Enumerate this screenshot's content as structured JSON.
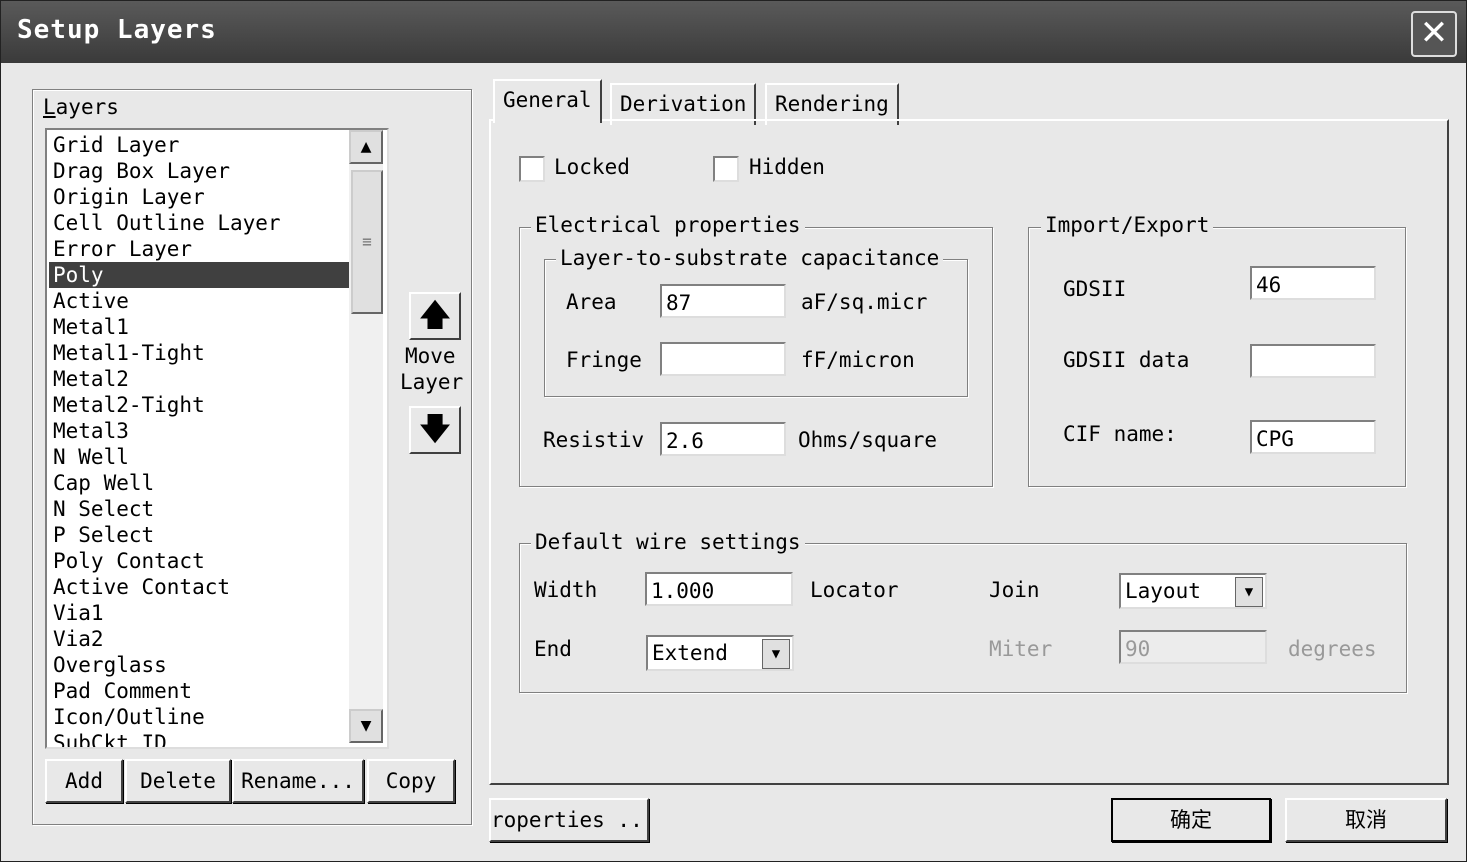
{
  "window": {
    "title": "Setup Layers",
    "close_label": "✕"
  },
  "layers": {
    "label": "Layers",
    "items": [
      "Grid Layer",
      "Drag Box Layer",
      "Origin Layer",
      "Cell Outline Layer",
      "Error Layer",
      "Poly",
      "Active",
      "Metal1",
      "Metal1-Tight",
      "Metal2",
      "Metal2-Tight",
      "Metal3",
      "N Well",
      "Cap Well",
      "N Select",
      "P Select",
      "Poly Contact",
      "Active Contact",
      "Via1",
      "Via2",
      "Overglass",
      "Pad Comment",
      "Icon/Outline",
      "SubCkt ID"
    ],
    "selected": "Poly",
    "buttons": {
      "add": "Add",
      "delete": "Delete",
      "rename": "Rename...",
      "copy": "Copy"
    },
    "move_label_line1": "Move",
    "move_label_line2": "Layer",
    "move_up_icon": "🡅",
    "move_down_icon": "🡇"
  },
  "tabs": [
    "General",
    "Derivation",
    "Rendering"
  ],
  "general": {
    "locked_label": "Locked",
    "hidden_label": "Hidden",
    "electrical": {
      "title": "Electrical properties",
      "capacitance_title": "Layer-to-substrate capacitance",
      "area_label": "Area",
      "area_value": "87",
      "area_unit": "aF/sq.micr",
      "fringe_label": "Fringe",
      "fringe_value": "",
      "fringe_unit": "fF/micron",
      "resistivity_label": "Resistiv",
      "resistivity_value": "2.6",
      "resistivity_unit": "Ohms/square"
    },
    "import_export": {
      "title": "Import/Export",
      "gdsii_label": "GDSII",
      "gdsii_value": "46",
      "gdsii_data_label": "GDSII data",
      "gdsii_data_value": "",
      "cif_label": "CIF name:",
      "cif_value": "CPG"
    },
    "wire": {
      "title": "Default wire settings",
      "width_label": "Width",
      "width_value": "1.000",
      "locator_label": "Locator",
      "join_label": "Join",
      "join_value": "Layout",
      "end_label": "End",
      "end_value": "Extend",
      "miter_label": "Miter",
      "miter_value": "90",
      "degrees_label": "degrees"
    }
  },
  "footer": {
    "properties": "roperties ..",
    "ok": "确定",
    "cancel": "取消"
  }
}
